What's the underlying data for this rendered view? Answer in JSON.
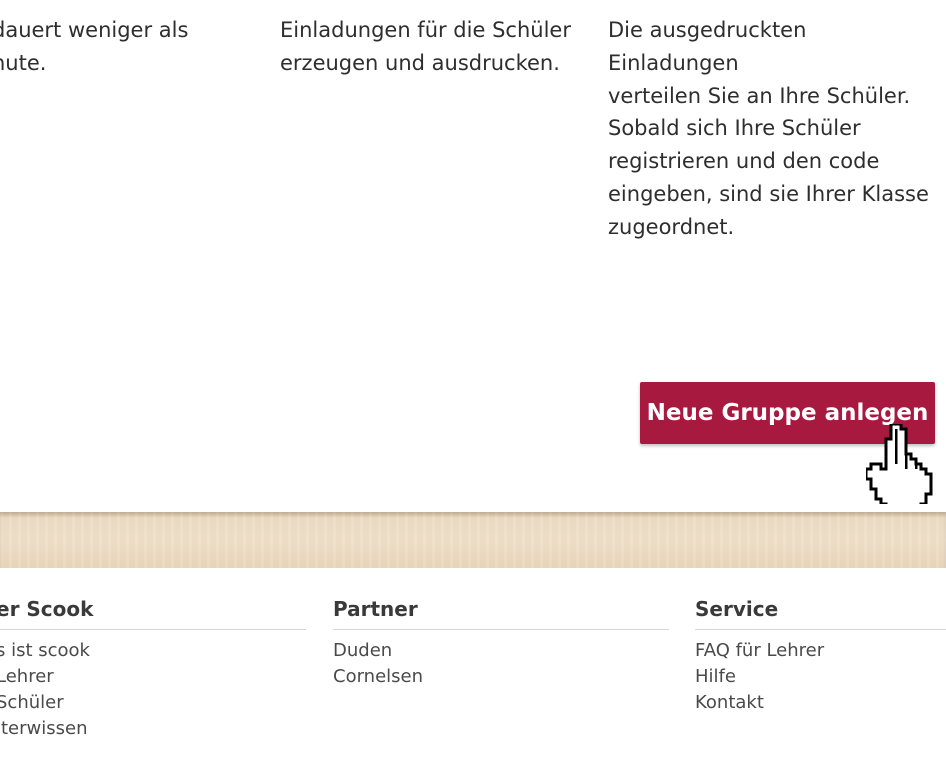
{
  "steps": {
    "step1": "dauert weniger als\nnute.",
    "step2": "Einladungen für die Schüler\nerzeugen und ausdrucken.",
    "step3": "Die ausgedruckten Einladungen\nverteilen Sie an Ihre Schüler.",
    "step3_more": "Sobald sich Ihre Schüler\nregistrieren und den code\neingeben, sind sie Ihrer Klasse\nzugeordnet."
  },
  "cta": {
    "label": "Neue Gruppe anlegen",
    "color": "#a8193f"
  },
  "cursor": {
    "icon": "hand-pointer-icon"
  },
  "footer": {
    "columns": [
      {
        "heading": "er Scook",
        "links": [
          "s ist scook",
          "Lehrer",
          "Schüler",
          "iterwissen"
        ]
      },
      {
        "heading": "Partner",
        "links": [
          "Duden",
          "Cornelsen"
        ]
      },
      {
        "heading": "Service",
        "links": [
          "FAQ für Lehrer",
          "Hilfe",
          "Kontakt"
        ]
      }
    ]
  }
}
